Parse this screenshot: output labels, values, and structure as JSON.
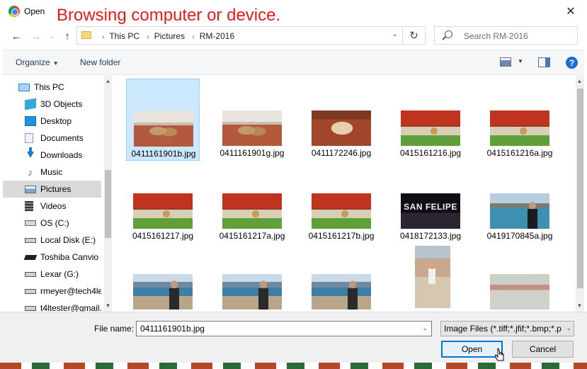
{
  "window": {
    "title": "Open"
  },
  "overlay_caption": "Browsing computer or device.",
  "toolbar": {
    "breadcrumb": [
      "This PC",
      "Pictures",
      "RM-2016"
    ],
    "search_placeholder": "Search RM-2016"
  },
  "command_bar": {
    "organize_label": "Organize",
    "new_folder_label": "New folder",
    "help_glyph": "?"
  },
  "sidebar": {
    "items": [
      {
        "label": "This PC",
        "icon": "computer-icon"
      },
      {
        "label": "3D Objects",
        "icon": "3d-objects-icon"
      },
      {
        "label": "Desktop",
        "icon": "desktop-icon"
      },
      {
        "label": "Documents",
        "icon": "documents-icon"
      },
      {
        "label": "Downloads",
        "icon": "downloads-icon"
      },
      {
        "label": "Music",
        "icon": "music-icon"
      },
      {
        "label": "Pictures",
        "icon": "pictures-icon",
        "selected": true
      },
      {
        "label": "Videos",
        "icon": "videos-icon"
      },
      {
        "label": "OS (C:)",
        "icon": "os-drive-icon"
      },
      {
        "label": "Local Disk (E:)",
        "icon": "drive-icon"
      },
      {
        "label": "Toshiba Canvio I",
        "icon": "usb-drive-icon"
      },
      {
        "label": "Lexar (G:)",
        "icon": "drive-icon"
      },
      {
        "label": "rmeyer@tech4le",
        "icon": "network-drive-icon"
      },
      {
        "label": "t4ltester@gmail.",
        "icon": "network-drive-icon"
      }
    ]
  },
  "files": [
    {
      "name": "0411161901b.jpg",
      "selected": true
    },
    {
      "name": "0411161901g.jpg"
    },
    {
      "name": "0411172246.jpg"
    },
    {
      "name": "0415161216.jpg"
    },
    {
      "name": "0415161216a.jpg"
    },
    {
      "name": "0415161217.jpg"
    },
    {
      "name": "0415161217a.jpg"
    },
    {
      "name": "0415161217b.jpg"
    },
    {
      "name": "0418172133.jpg"
    },
    {
      "name": "0419170845a.jpg"
    },
    {
      "name": ""
    },
    {
      "name": ""
    },
    {
      "name": ""
    },
    {
      "name": ""
    },
    {
      "name": ""
    }
  ],
  "footer": {
    "file_name_label": "File name:",
    "file_name_value": "0411161901b.jpg",
    "file_type_value": "Image Files (*.tiff;*.jfif;*.bmp;*.p",
    "open_label": "Open",
    "cancel_label": "Cancel"
  },
  "colors": {
    "accent": "#0078d7",
    "caption": "#e01c1c",
    "selection": "#cce8ff"
  }
}
